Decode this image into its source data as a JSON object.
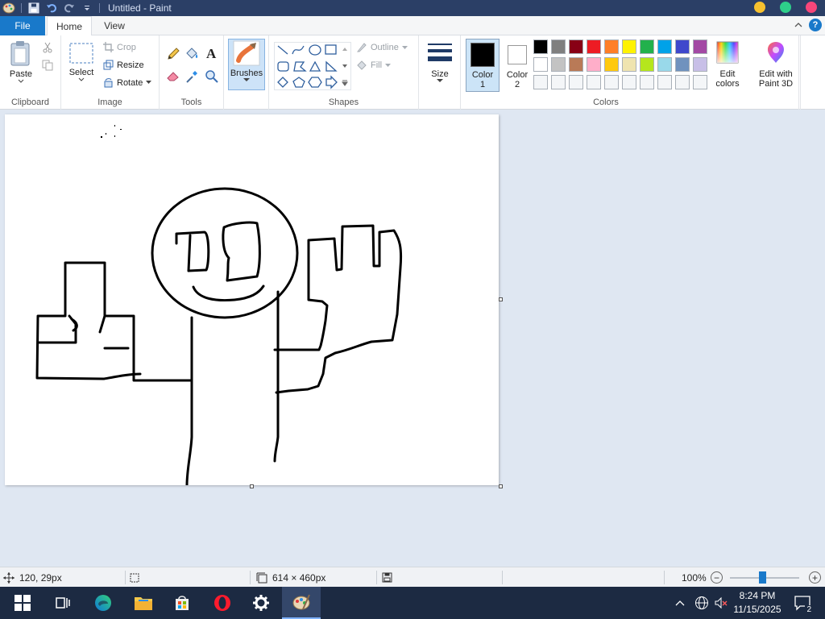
{
  "window": {
    "title": "Untitled - Paint"
  },
  "tabs": {
    "file": "File",
    "home": "Home",
    "view": "View"
  },
  "ribbon": {
    "clipboard": {
      "label": "Clipboard",
      "paste": "Paste"
    },
    "image": {
      "label": "Image",
      "select": "Select",
      "crop": "Crop",
      "resize": "Resize",
      "rotate": "Rotate"
    },
    "tools": {
      "label": "Tools"
    },
    "brushes": {
      "label": "Brushes"
    },
    "shapes": {
      "label": "Shapes",
      "outline": "Outline",
      "fill": "Fill"
    },
    "size": {
      "label": "Size"
    },
    "colors": {
      "label": "Colors",
      "color1": "Color",
      "color1_num": "1",
      "color2": "Color",
      "color2_num": "2",
      "edit_colors_line1": "Edit",
      "edit_colors_line2": "colors",
      "paint3d_line1": "Edit with",
      "paint3d_line2": "Paint 3D",
      "color1_value": "#000000",
      "color2_value": "#ffffff",
      "palette_row1": [
        "#000000",
        "#7f7f7f",
        "#880015",
        "#ed1c24",
        "#ff7f27",
        "#fff200",
        "#22b14c",
        "#00a2e8",
        "#3f48cc",
        "#a349a4"
      ],
      "palette_row2": [
        "#ffffff",
        "#c3c3c3",
        "#b97a57",
        "#ffaec9",
        "#ffc90e",
        "#efe4b0",
        "#b5e61d",
        "#99d9ea",
        "#7092be",
        "#c8bfe7"
      ],
      "palette_row3": [
        "#f4f6f8",
        "#f4f6f8",
        "#f4f6f8",
        "#f4f6f8",
        "#f4f6f8",
        "#f4f6f8",
        "#f4f6f8",
        "#f4f6f8",
        "#f4f6f8",
        "#f4f6f8"
      ]
    }
  },
  "status": {
    "cursor_pos": "120, 29px",
    "canvas_size": "614 × 460px",
    "zoom": "100%",
    "zoom_fraction": 0.47
  },
  "taskbar": {
    "time": "8:24 PM",
    "date": "11/15/2025",
    "notification_count": "2"
  },
  "accent": "#1979ca"
}
